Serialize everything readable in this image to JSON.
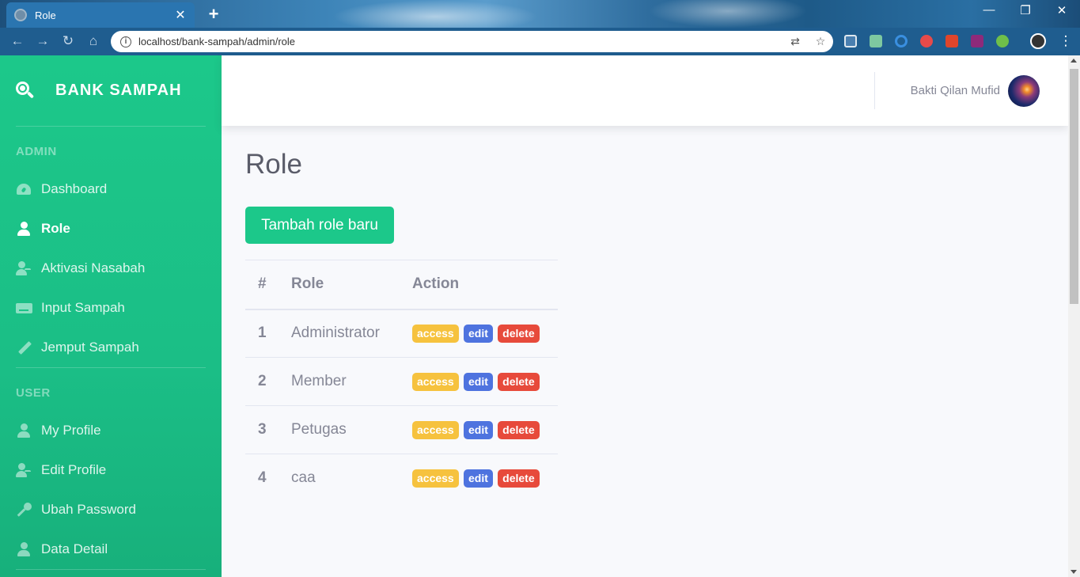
{
  "browser": {
    "tab_title": "Role",
    "tab_close": "✕",
    "new_tab": "+",
    "url": "localhost/bank-sampah/admin/role",
    "window_controls": [
      "—",
      "❐",
      "✕"
    ]
  },
  "sidebar": {
    "brand": "BANK SAMPAH",
    "admin_heading": "ADMIN",
    "user_heading": "USER",
    "admin_items": [
      {
        "label": "Dashboard",
        "icon": "tachometer-icon"
      },
      {
        "label": "Role",
        "icon": "user-tie-icon",
        "active": true
      },
      {
        "label": "Aktivasi Nasabah",
        "icon": "user-check-icon"
      },
      {
        "label": "Input Sampah",
        "icon": "keyboard-icon"
      },
      {
        "label": "Jemput Sampah",
        "icon": "pen-icon"
      }
    ],
    "user_items": [
      {
        "label": "My Profile",
        "icon": "user-icon"
      },
      {
        "label": "Edit Profile",
        "icon": "user-edit-icon"
      },
      {
        "label": "Ubah Password",
        "icon": "key-icon"
      },
      {
        "label": "Data Detail",
        "icon": "user-tie-icon"
      }
    ]
  },
  "topbar": {
    "user_name": "Bakti Qilan Mufid"
  },
  "main": {
    "title": "Role",
    "add_button": "Tambah role baru",
    "table": {
      "headers": [
        "#",
        "Role",
        "Action"
      ],
      "rows": [
        {
          "num": "1",
          "role": "Administrator"
        },
        {
          "num": "2",
          "role": "Member"
        },
        {
          "num": "3",
          "role": "Petugas"
        },
        {
          "num": "4",
          "role": "caa"
        }
      ],
      "actions": {
        "access": "access",
        "edit": "edit",
        "delete": "delete"
      }
    }
  },
  "colors": {
    "sidebar": "#1cc88a",
    "access": "#f6c23e",
    "edit": "#4e73df",
    "delete": "#e74a3b"
  }
}
